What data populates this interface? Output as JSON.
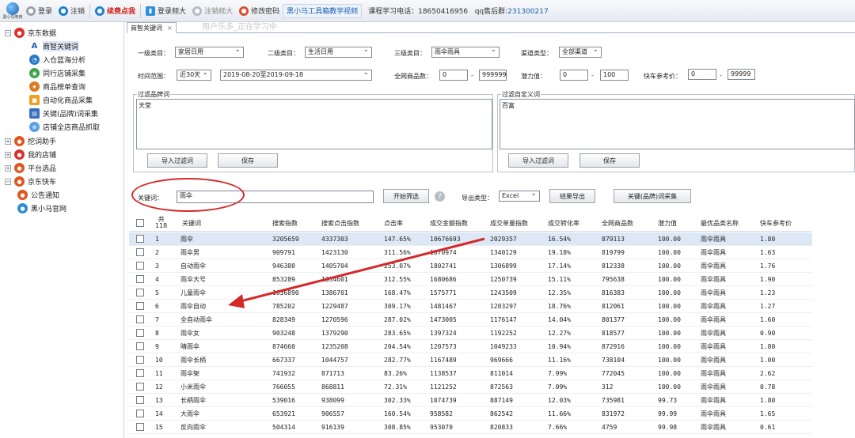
{
  "toolbar": {
    "logo_text": "黑小马电商",
    "login": "登录",
    "logout": "注销",
    "renew": "续费点我",
    "login_shop": "登录频大",
    "logout_shop": "注销频大",
    "change_pwd": "修改密码",
    "tutorial": "黑小马工具箱教学视频",
    "phone_text": "课程学习电话：18650416956",
    "qq_label": "qq售后群:",
    "qq_value": "231300217"
  },
  "sidebar": {
    "items": [
      {
        "label": "京东数据",
        "expander": "⊟",
        "icon": "jd-icon"
      },
      {
        "label": "商智关键词"
      },
      {
        "label": "入仓蓝海分析"
      },
      {
        "label": "同行店铺采集"
      },
      {
        "label": "商品榜单查询"
      },
      {
        "label": "自动化商品采集"
      },
      {
        "label": "关键(品牌)词采集"
      },
      {
        "label": "店铺全店商品抓取"
      },
      {
        "label": "挖词助手",
        "expander": "⊞"
      },
      {
        "label": "我的店铺",
        "expander": "⊞"
      },
      {
        "label": "平台选品",
        "expander": "⊞"
      },
      {
        "label": "京东快车",
        "expander": "⊟"
      },
      {
        "label": "公告通知"
      },
      {
        "label": "黑小马官网"
      }
    ]
  },
  "tab": {
    "label": "商智关键词",
    "close": "×"
  },
  "watermark": "用户乐多_正在学习中",
  "filters": {
    "cat1_label": "一级类目：",
    "cat1_value": "家居日用",
    "cat2_label": "二级类目：",
    "cat2_value": "生活日用",
    "cat3_label": "三级类目：",
    "cat3_value": "雨伞雨具",
    "channel_label": "渠道类型：",
    "channel_value": "全部渠道",
    "time_label": "时间范围：",
    "time_value": "近30天",
    "date_value": "2019-08-20至2019-09-18",
    "total_goods_label": "全网商品数：",
    "total_goods_min": "0",
    "total_goods_max": "9999999",
    "potential_label": "潜力值：",
    "potential_min": "0",
    "potential_max": "100",
    "express_label": "快车参考价：",
    "express_min": "0",
    "express_max": "99999",
    "dash": "-"
  },
  "brand_filter": {
    "title": "过滤品牌词",
    "content": "天堂",
    "import_btn": "导入过滤词",
    "save_btn": "保存"
  },
  "custom_filter": {
    "title": "过滤自定义词",
    "content": "百富",
    "import_btn": "导入过滤词",
    "save_btn": "保存"
  },
  "search": {
    "keyword_label": "关键词：",
    "keyword_value": "雨伞",
    "start_btn": "开始筛选",
    "help": "?",
    "export_label": "导出类型：",
    "export_value": "Excel",
    "export_btn": "结果导出",
    "collect_btn": "关键(品牌)词采集"
  },
  "table": {
    "total_label": "共",
    "total_count": "118",
    "headers": [
      "关键词",
      "搜索指数",
      "搜索点击指数",
      "点击率",
      "成交金额指数",
      "成交单量指数",
      "成交转化率",
      "全网商品数",
      "潜力值",
      "最优品类名称",
      "快车参考价"
    ],
    "rows": [
      [
        "1",
        "雨伞",
        "3205659",
        "4337303",
        "147.65%",
        "10676693",
        "2029357",
        "16.54%",
        "879113",
        "100.00",
        "雨伞雨具",
        "1.80"
      ],
      [
        "2",
        "雨伞男",
        "909791",
        "1423130",
        "311.56%",
        "1870974",
        "1340129",
        "19.18%",
        "819799",
        "100.00",
        "雨伞雨具",
        "1.63"
      ],
      [
        "3",
        "自动雨伞",
        "946380",
        "1405704",
        "253.07%",
        "1802741",
        "1306899",
        "17.14%",
        "812338",
        "100.00",
        "雨伞雨具",
        "1.76"
      ],
      [
        "4",
        "雨伞大号",
        "853289",
        "1334601",
        "312.55%",
        "1680686",
        "1250739",
        "15.11%",
        "795638",
        "100.00",
        "雨伞雨具",
        "1.90"
      ],
      [
        "5",
        "儿童雨伞",
        "1036890",
        "1386701",
        "168.47%",
        "1575771",
        "1243509",
        "12.35%",
        "816383",
        "100.00",
        "雨伞雨具",
        "1.23"
      ],
      [
        "6",
        "雨伞自动",
        "785202",
        "1229487",
        "309.17%",
        "1481467",
        "1203297",
        "18.76%",
        "812061",
        "100.00",
        "雨伞雨具",
        "1.27"
      ],
      [
        "7",
        "全自动雨伞",
        "828349",
        "1270596",
        "287.02%",
        "1473005",
        "1176147",
        "14.04%",
        "801377",
        "100.00",
        "雨伞雨具",
        "1.60"
      ],
      [
        "8",
        "雨伞女",
        "903248",
        "1379290",
        "283.65%",
        "1397324",
        "1192252",
        "12.27%",
        "818577",
        "100.00",
        "雨伞雨具",
        "0.90"
      ],
      [
        "9",
        "晴雨伞",
        "874660",
        "1235208",
        "204.54%",
        "1207573",
        "1049233",
        "10.94%",
        "872916",
        "100.00",
        "雨伞雨具",
        "1.80"
      ],
      [
        "10",
        "雨伞长柄",
        "667337",
        "1044757",
        "282.77%",
        "1167489",
        "969666",
        "11.16%",
        "738104",
        "100.00",
        "雨伞雨具",
        "1.00"
      ],
      [
        "11",
        "雨伞架",
        "741932",
        "871713",
        "83.26%",
        "1138537",
        "811014",
        "7.99%",
        "772045",
        "100.00",
        "雨伞雨具",
        "2.62"
      ],
      [
        "12",
        "小米雨伞",
        "766055",
        "868811",
        "72.31%",
        "1121252",
        "872563",
        "7.09%",
        "312",
        "100.00",
        "雨伞雨具",
        "0.78"
      ],
      [
        "13",
        "长柄雨伞",
        "539016",
        "938099",
        "302.33%",
        "1074739",
        "887149",
        "12.03%",
        "735981",
        "99.73",
        "雨伞雨具",
        "1.80"
      ],
      [
        "14",
        "大雨伞",
        "653921",
        "906557",
        "160.54%",
        "958582",
        "862542",
        "11.66%",
        "831972",
        "99.99",
        "雨伞雨具",
        "1.65"
      ],
      [
        "15",
        "反向雨伞",
        "504314",
        "916139",
        "308.85%",
        "953070",
        "820833",
        "7.66%",
        "4759",
        "99.98",
        "雨伞雨具",
        "0.61"
      ]
    ]
  },
  "colors": {
    "annotation": "#d42a2a",
    "selected_row": "#dde8f6",
    "accent": "#1a5fb4"
  }
}
